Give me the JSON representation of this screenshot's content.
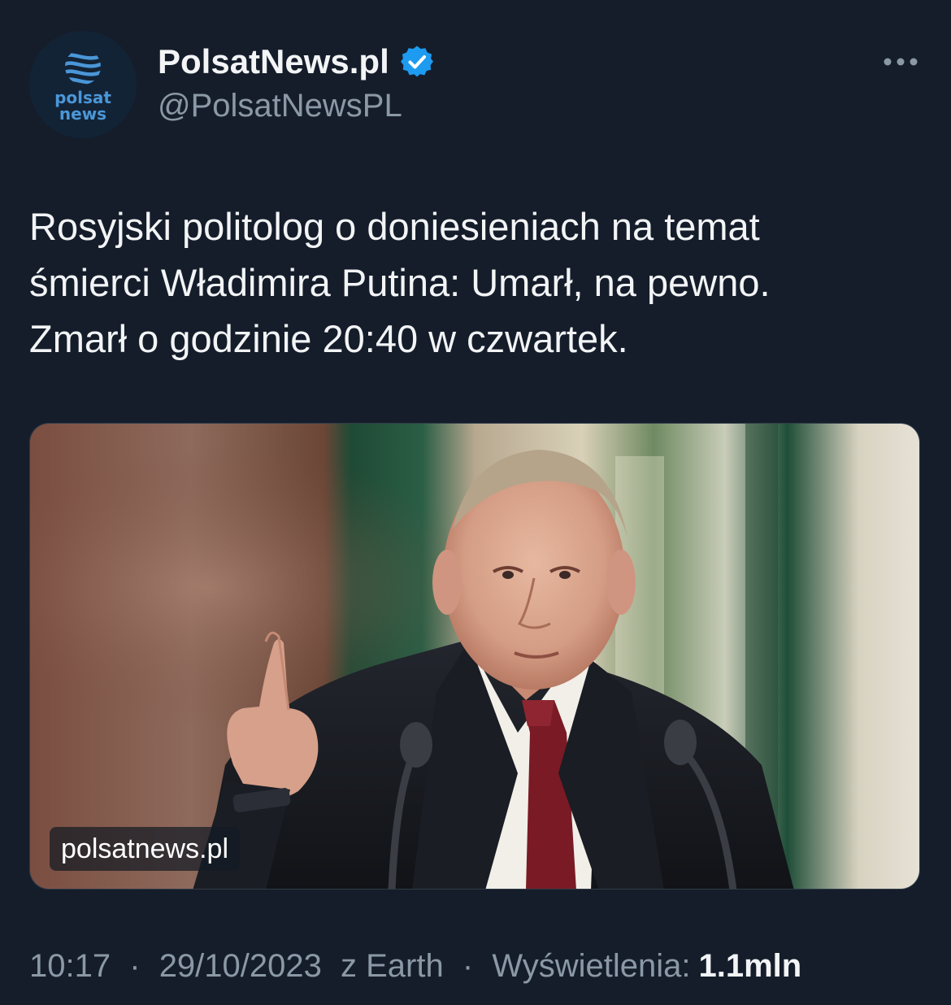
{
  "author": {
    "display_name": "PolsatNews.pl",
    "handle": "@PolsatNewsPL",
    "verified": true,
    "avatar_text_line1": "polsat",
    "avatar_text_line2": "news"
  },
  "more_icon": "more-horizontal-icon",
  "tweet": {
    "text": "Rosyjski politolog o doniesieniach na temat\nśmierci Władimira Putina: Umarł, na pewno.\nZmarł o godzinie 20:40 w czwartek."
  },
  "media": {
    "source_label": "polsatnews.pl"
  },
  "meta": {
    "time": "10:17",
    "separator": "·",
    "date": "29/10/2023",
    "source": "z Earth",
    "views_label": "Wyświetlenia:",
    "views_count": "1.1mln"
  },
  "colors": {
    "background": "#151d2b",
    "text_primary": "#f2f4f5",
    "text_secondary": "#8b98a5",
    "verified_blue": "#1d9bf0",
    "logo_blue": "#4a97d8"
  }
}
